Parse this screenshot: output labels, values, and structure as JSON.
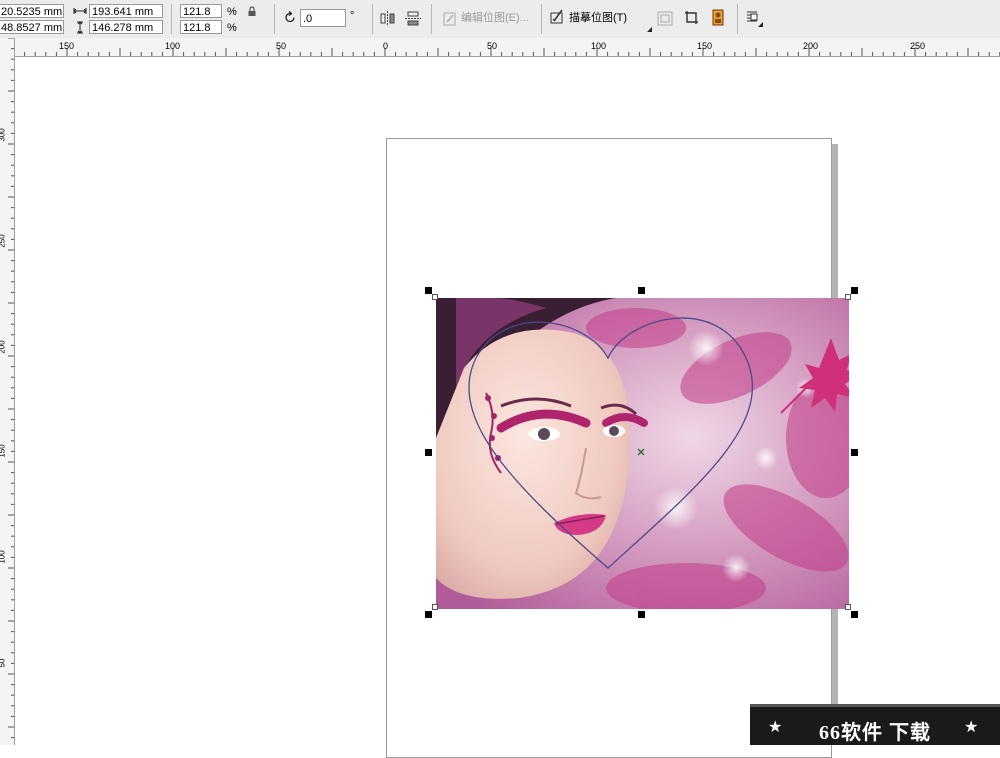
{
  "propertybar": {
    "x_pos": "20.5235 mm",
    "y_pos": "48.8527 mm",
    "width": "193.641 mm",
    "height": "146.278 mm",
    "scale_x": "121.8",
    "scale_y": "121.8",
    "percent": "%",
    "rotation": ".0",
    "degree": "°",
    "edit_bitmap": "编辑位图(E)...",
    "trace_bitmap": "描摹位图(T)"
  },
  "ruler": {
    "h_ticks": [
      "150",
      "100",
      "50",
      "0",
      "50",
      "100",
      "150",
      "200",
      "250"
    ],
    "v_ticks": [
      "300",
      "250",
      "200",
      "150",
      "100",
      "50"
    ]
  },
  "watermark": {
    "text": "66软件 下载",
    "star": "★"
  },
  "colors": {
    "accent": "#c8287a",
    "outline": "#4a4a8a"
  }
}
